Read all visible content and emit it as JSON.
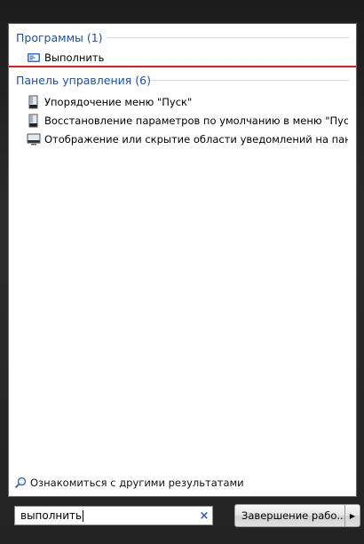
{
  "results": {
    "programs": {
      "header": "Программы (1)",
      "items": [
        {
          "label": "Выполнить",
          "icon": "run-icon"
        }
      ]
    },
    "control_panel": {
      "header": "Панель управления (6)",
      "items": [
        {
          "label": "Упорядочение меню \"Пуск\"",
          "icon": "taskbar-start-menu-icon"
        },
        {
          "label": "Восстановление параметров по умолчанию в меню \"Пуск\"",
          "icon": "taskbar-start-menu-icon"
        },
        {
          "label": "Отображение или скрытие области уведомлений на панели з...",
          "icon": "notification-area-icon"
        }
      ]
    },
    "see_more": "Ознакомиться с другими результатами"
  },
  "search": {
    "value": "выполнить",
    "clear_symbol": "×"
  },
  "shutdown": {
    "label": "Завершение рабо...",
    "arrow": "▶"
  },
  "colors": {
    "header": "#1e4f9c",
    "highlight_line": "#e02020"
  }
}
